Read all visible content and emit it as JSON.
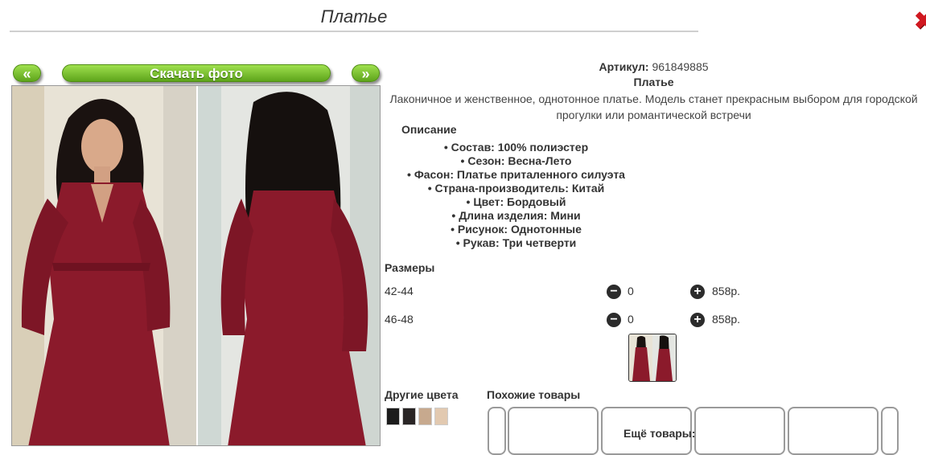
{
  "header": {
    "title": "Платье",
    "close_icon": "close-icon"
  },
  "gallery": {
    "prev_label": "«",
    "next_label": "»",
    "download_label": "Скачать фото"
  },
  "product": {
    "sku_label": "Артикул:",
    "sku_value": "961849885",
    "name": "Платье",
    "description": "Лаконичное и женственное, однотонное платье. Модель станет прекрасным выбором для городской прогулки или романтической встречи",
    "description_heading": "Описание",
    "properties": [
      "Состав: 100% полиэстер",
      "Сезон: Весна-Лето",
      "Фасон: Платье приталенного силуэта",
      "Страна-производитель: Китай",
      "Цвет: Бордовый",
      "Длина изделия: Мини",
      "Рисунок: Однотонные",
      "Рукав: Три четверти"
    ]
  },
  "sizes": {
    "heading": "Размеры",
    "rows": [
      {
        "size": "42-44",
        "qty": "0",
        "price": "858р."
      },
      {
        "size": "46-48",
        "qty": "0",
        "price": "858р."
      }
    ]
  },
  "other_colors": {
    "heading": "Другие цвета"
  },
  "similar": {
    "heading": "Похожие товары"
  },
  "more": {
    "heading": "Ещё товары:"
  },
  "colors": {
    "accent_green": "#6fb524",
    "dress": "#8b1a2b",
    "close_red": "#d01820"
  }
}
